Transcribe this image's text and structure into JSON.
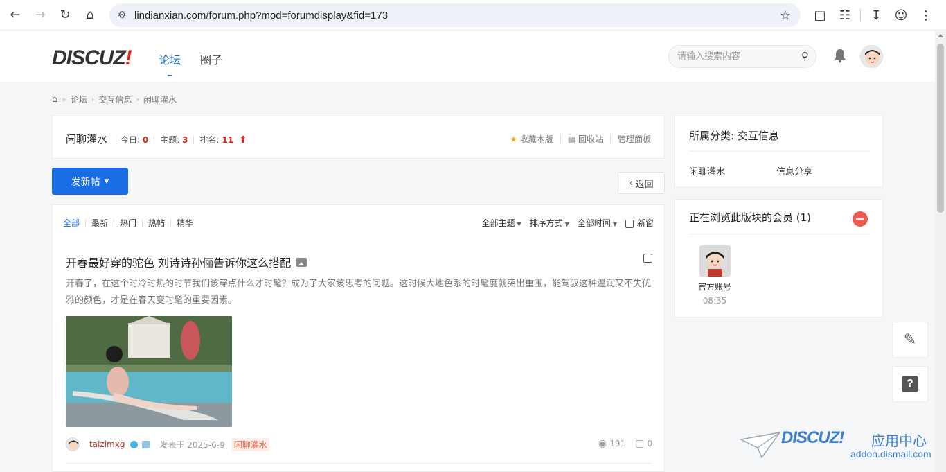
{
  "browser": {
    "url": "lindianxian.com/forum.php?mod=forumdisplay&fid=173"
  },
  "header": {
    "logo_text": "DISCUZ",
    "logo_bang": "!",
    "nav": [
      {
        "label": "论坛",
        "active": true
      },
      {
        "label": "圈子",
        "active": false
      }
    ],
    "search_placeholder": "请输入搜索内容"
  },
  "breadcrumb": [
    "论坛",
    "交互信息",
    "闲聊灌水"
  ],
  "forum": {
    "name": "闲聊灌水",
    "today_label": "今日:",
    "today_value": "0",
    "topics_label": "主题:",
    "topics_value": "3",
    "rank_label": "排名:",
    "rank_value": "11",
    "favorite_label": "收藏本版",
    "recycle_label": "回收站",
    "manage_label": "管理面板"
  },
  "actions": {
    "new_post": "发新帖",
    "back": "返回"
  },
  "filters": {
    "tabs": [
      {
        "label": "全部",
        "active": true
      },
      {
        "label": "最新",
        "active": false
      },
      {
        "label": "热门",
        "active": false
      },
      {
        "label": "热帖",
        "active": false
      },
      {
        "label": "精华",
        "active": false
      }
    ],
    "all_topics": "全部主题",
    "sort": "排序方式",
    "all_time": "全部时间",
    "new_window": "新窗"
  },
  "thread": {
    "title": "开春最好穿的驼色 刘诗诗孙俪告诉你这么搭配",
    "summary": "开春了，在这个时冷时热的时节我们该穿点什么才时髦？成为了大家该思考的问题。这时候大地色系的时髦度就突出重围，能驾驭这种温润又不失优雅的颜色，才是在春天变时髦的重要因素。",
    "author": "taizimxg",
    "posted": "发表于 2025-6-9",
    "forum_tag": "闲聊灌水",
    "views": "191",
    "replies": "0"
  },
  "sidebar": {
    "category_title": "所属分类: 交互信息",
    "category_items": [
      "闲聊灌水",
      "信息分享"
    ],
    "members_title": "正在浏览此版块的会员 (1)",
    "members": [
      {
        "name": "官方账号",
        "time": "08:35"
      }
    ]
  },
  "watermark": {
    "brand": "DISCUZ",
    "bang": "!",
    "cn": "应用中心",
    "url": "addon.dismall.com"
  },
  "colors": {
    "primary": "#1a6ee5",
    "accent_red": "#e1251b",
    "watermark_blue": "#3e7fd0"
  }
}
